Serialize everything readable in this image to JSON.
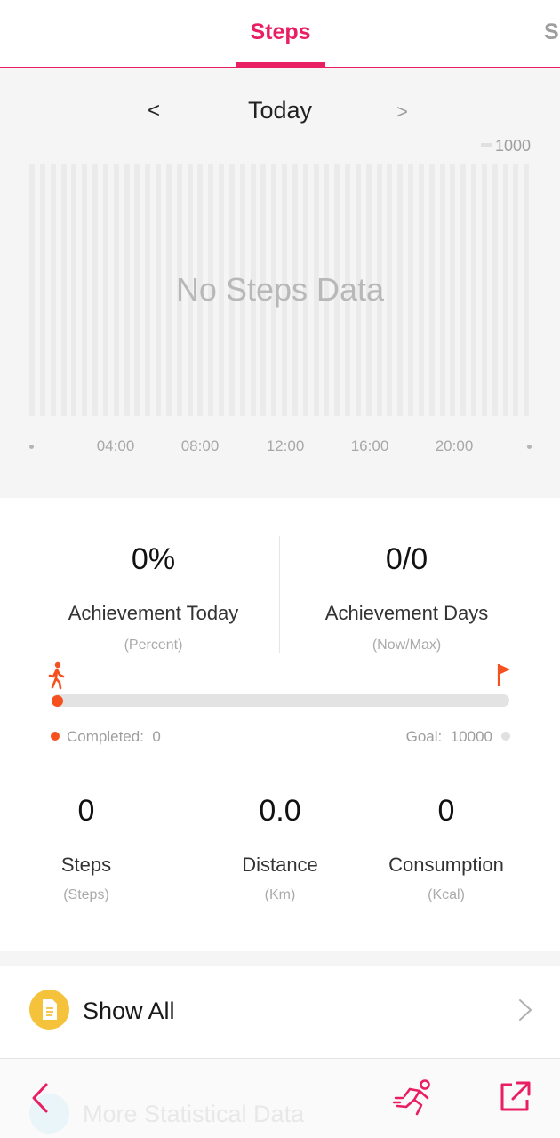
{
  "tabs": {
    "active": "Steps",
    "next_partial": "S"
  },
  "date_nav": {
    "prev": "<",
    "label": "Today",
    "next": ">"
  },
  "chart_data": {
    "type": "bar",
    "y_max_label": "1000",
    "ylim": [
      0,
      1000
    ],
    "x_tick_labels": [
      "04:00",
      "08:00",
      "12:00",
      "16:00",
      "20:00"
    ],
    "values": [],
    "empty_message": "No Steps Data",
    "grid": false
  },
  "achievement": {
    "today": {
      "value": "0%",
      "title": "Achievement Today",
      "unit": "(Percent)"
    },
    "days": {
      "value": "0/0",
      "title": "Achievement Days",
      "unit": "(Now/Max)"
    }
  },
  "progress": {
    "completed_label": "Completed:",
    "completed_value": "0",
    "goal_label": "Goal:",
    "goal_value": "10000",
    "fraction": 0,
    "accent_color": "#f4511e"
  },
  "metrics": [
    {
      "value": "0",
      "title": "Steps",
      "unit": "(Steps)"
    },
    {
      "value": "0.0",
      "title": "Distance",
      "unit": "(Km)"
    },
    {
      "value": "0",
      "title": "Consumption",
      "unit": "(Kcal)"
    }
  ],
  "show_all": {
    "label": "Show All",
    "icon": "document-icon",
    "icon_color": "#f5c23c"
  },
  "more_stats": {
    "label": "More Statistical Data"
  },
  "bottom_bar": {
    "back_icon": "back-arrow-icon",
    "run_icon": "runner-icon",
    "share_icon": "share-icon",
    "accent_color": "#e91e63"
  }
}
